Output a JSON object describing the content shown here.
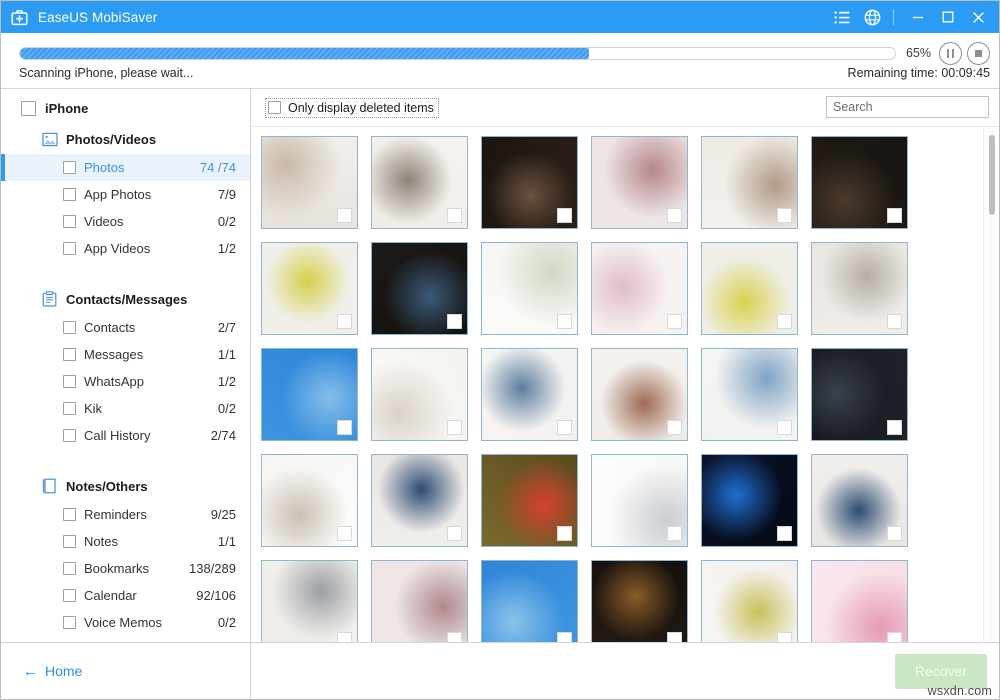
{
  "window": {
    "title": "EaseUS MobiSaver",
    "logo_icon": "first-aid-kit-icon",
    "list_icon": "list-menu-icon",
    "globe_icon": "globe-icon",
    "minimize_icon": "minimize-icon",
    "maximize_icon": "maximize-icon",
    "close_icon": "close-icon",
    "titlebar_color": "#2b9bf4"
  },
  "progress": {
    "percent_label": "65%",
    "percent_value": 65,
    "status_text": "Scanning iPhone, please wait...",
    "remaining_text": "Remaining time: 00:09:45",
    "pause_icon": "pause-icon",
    "stop_icon": "stop-icon",
    "fill_color": "#3d9bf2"
  },
  "sidebar": {
    "root": {
      "label": "iPhone",
      "checked": false
    },
    "sections": [
      {
        "label": "Photos/Videos",
        "icon": "image-icon",
        "items": [
          {
            "label": "Photos",
            "count": "74 /74",
            "selected": true
          },
          {
            "label": "App Photos",
            "count": "7/9",
            "selected": false
          },
          {
            "label": "Videos",
            "count": "0/2",
            "selected": false
          },
          {
            "label": "App Videos",
            "count": "1/2",
            "selected": false
          }
        ]
      },
      {
        "label": "Contacts/Messages",
        "icon": "clipboard-icon",
        "items": [
          {
            "label": "Contacts",
            "count": "2/7",
            "selected": false
          },
          {
            "label": "Messages",
            "count": "1/1",
            "selected": false
          },
          {
            "label": "WhatsApp",
            "count": "1/2",
            "selected": false
          },
          {
            "label": "Kik",
            "count": "0/2",
            "selected": false
          },
          {
            "label": "Call History",
            "count": "2/74",
            "selected": false
          }
        ]
      },
      {
        "label": "Notes/Others",
        "icon": "notebook-icon",
        "items": [
          {
            "label": "Reminders",
            "count": "9/25",
            "selected": false
          },
          {
            "label": "Notes",
            "count": "1/1",
            "selected": false
          },
          {
            "label": "Bookmarks",
            "count": "138/289",
            "selected": false
          },
          {
            "label": "Calendar",
            "count": "92/106",
            "selected": false
          },
          {
            "label": "Voice Memos",
            "count": "0/2",
            "selected": false
          }
        ]
      }
    ],
    "home": {
      "label": "Home",
      "arrow_icon": "arrow-left-icon"
    }
  },
  "main": {
    "only_deleted_label": "Only display deleted items",
    "only_deleted_checked": false,
    "search_placeholder": "Search",
    "search_value": "",
    "recover_label": "Recover",
    "recover_enabled": false,
    "recover_color": "#cbe6c4",
    "watermark": "wsxdn.com",
    "thumbnails": [
      {
        "alt": "family-at-computer",
        "c1": "#e8e2dc",
        "c2": "#c9b9a8",
        "c3": "#f2efeb"
      },
      {
        "alt": "office-workspace-people",
        "c1": "#efeae4",
        "c2": "#8e8378",
        "c3": "#f6f3ef"
      },
      {
        "alt": "woman-at-night-window",
        "c1": "#1b1510",
        "c2": "#6b5140",
        "c3": "#2a1f18"
      },
      {
        "alt": "man-in-library-blur",
        "c1": "#f0e3e3",
        "c2": "#b4868a",
        "c3": "#ece7e7"
      },
      {
        "alt": "woman-child-gift",
        "c1": "#efe9e2",
        "c2": "#b09a88",
        "c3": "#f4f1ee"
      },
      {
        "alt": "woman-reading-dark",
        "c1": "#181410",
        "c2": "#4a3a2c",
        "c3": "#241c16"
      },
      {
        "alt": "mother-daughter-tulips",
        "c1": "#f2eee9",
        "c2": "#d6cf4a",
        "c3": "#eff0ea"
      },
      {
        "alt": "man-laptop-city-night",
        "c1": "#12100e",
        "c2": "#3b5a78",
        "c3": "#1c1a18"
      },
      {
        "alt": "bright-living-room",
        "c1": "#fbfbfa",
        "c2": "#cfd9c4",
        "c3": "#f4f4f2"
      },
      {
        "alt": "blurred-bokeh-colors",
        "c1": "#f6eef0",
        "c2": "#e0bcc6",
        "c3": "#f7f3f2"
      },
      {
        "alt": "yellow-tulips-woman",
        "c1": "#f1eee8",
        "c2": "#d8d24e",
        "c3": "#eeefe8"
      },
      {
        "alt": "wooden-deck-planks",
        "c1": "#e9e6e1",
        "c2": "#b6aea4",
        "c3": "#f0eeea"
      },
      {
        "alt": "blue-sky-clouds",
        "c1": "#2f86d8",
        "c2": "#86bfe9",
        "c3": "#3d94e0"
      },
      {
        "alt": "white-dining-room",
        "c1": "#f4f2ef",
        "c2": "#d9d2c7",
        "c3": "#fbfaf8"
      },
      {
        "alt": "man-working-laptop",
        "c1": "#f2f1ef",
        "c2": "#5c7d9e",
        "c3": "#f7f6f4"
      },
      {
        "alt": "team-meeting-table",
        "c1": "#efece8",
        "c2": "#9e6a52",
        "c3": "#f4f1ee"
      },
      {
        "alt": "two-men-with-laptop",
        "c1": "#f1f1ef",
        "c2": "#7fa2c4",
        "c3": "#f7f7f5"
      },
      {
        "alt": "couple-night-skyline",
        "c1": "#15171c",
        "c2": "#3a424e",
        "c3": "#1f2229"
      },
      {
        "alt": "woman-white-desk",
        "c1": "#f6f5f3",
        "c2": "#cbbfb2",
        "c3": "#fbfbfa"
      },
      {
        "alt": "group-around-computer",
        "c1": "#e9e6e2",
        "c2": "#2c4a72",
        "c3": "#f1efec"
      },
      {
        "alt": "woman-colorful-umbrella",
        "c1": "#5b4a1e",
        "c2": "#d6402f",
        "c3": "#7a6a2c"
      },
      {
        "alt": "people-in-bright-office",
        "c1": "#f7f7f6",
        "c2": "#c9cdd2",
        "c3": "#fcfcfb"
      },
      {
        "alt": "earth-from-space",
        "c1": "#050a18",
        "c2": "#1f6fd0",
        "c3": "#0b1228"
      },
      {
        "alt": "family-looking-at-pc",
        "c1": "#e9e6e2",
        "c2": "#2c4a72",
        "c3": "#f1efec"
      },
      {
        "alt": "business-lunch-table",
        "c1": "#efece7",
        "c2": "#9aa0a6",
        "c3": "#f4f2ee"
      },
      {
        "alt": "man-in-bookstore",
        "c1": "#f0e6e6",
        "c2": "#b0878c",
        "c3": "#ece8e8"
      },
      {
        "alt": "blue-sky-wide",
        "c1": "#2f86d8",
        "c2": "#8cc3ea",
        "c3": "#3f96e0"
      },
      {
        "alt": "woman-candle-light",
        "c1": "#14100c",
        "c2": "#8a5c28",
        "c3": "#241a12"
      },
      {
        "alt": "mother-child-flowers",
        "c1": "#f3f0ec",
        "c2": "#c8c05a",
        "c3": "#f7f5f2"
      },
      {
        "alt": "pink-roses-card",
        "c1": "#f7dce4",
        "c2": "#e59ab4",
        "c3": "#f9e8ee"
      }
    ]
  }
}
